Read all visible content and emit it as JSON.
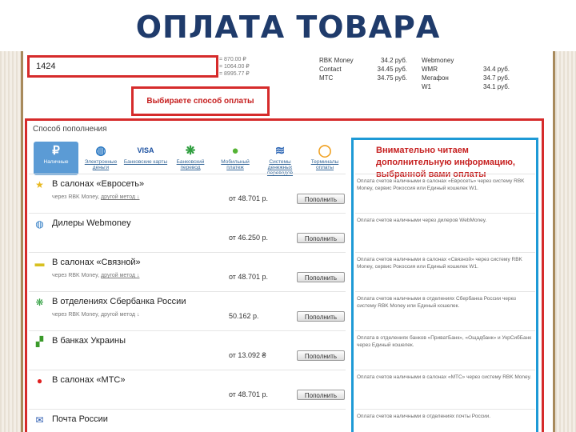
{
  "slide_title": "ОПЛАТА ТОВАРА",
  "top": {
    "account_value": "1424",
    "rates": [
      "= 870.00 ₽",
      "= 1064.00 ₽",
      "= 8995.77 ₽"
    ],
    "rate_table_left": [
      {
        "name": "RBK Money",
        "value": "34.2 руб."
      },
      {
        "name": "Contact",
        "value": "34.45 руб."
      },
      {
        "name": "МТС",
        "value": "34.75 руб."
      }
    ],
    "rate_table_right": [
      {
        "name": "Webmoney WMR",
        "value": "34.4 руб."
      },
      {
        "name": "Мегафон",
        "value": "34.7 руб."
      },
      {
        "name": "W1",
        "value": "34.1 руб."
      }
    ]
  },
  "annotation_choose": "Выбираете способ оплаты",
  "annotation_note": "Внимательно читаем дополнительную информацию, выбранной вами оплаты",
  "section_title": "Способ пополнения",
  "methods": [
    {
      "label": "Наличные",
      "icon": "ruble-icon",
      "glyph": "₽",
      "color": "#ffffff"
    },
    {
      "label": "Электронные деньги",
      "icon": "globe-icon",
      "glyph": "◍",
      "color": "#2a78c2"
    },
    {
      "label": "Банковские карты",
      "icon": "visa-icon",
      "glyph": "VISA",
      "color": "#1a4fa0"
    },
    {
      "label": "Банковский перевод",
      "icon": "sberbank-icon",
      "glyph": "❋",
      "color": "#2e9e3e"
    },
    {
      "label": "Мобильный платеж",
      "icon": "sms-icon",
      "glyph": "●",
      "color": "#55b334"
    },
    {
      "label": "Системы денежных переводов",
      "icon": "transfer-icon",
      "glyph": "≋",
      "color": "#3169b6"
    },
    {
      "label": "Терминалы оплаты",
      "icon": "terminal-icon",
      "glyph": "◯",
      "color": "#f0a020"
    }
  ],
  "rows": [
    {
      "title": "В салонах «Евросеть»",
      "sub": "через RBK Money, ",
      "sub_link": "другой метод ↓",
      "amount": "от 48.701 р.",
      "button": "Пополнить",
      "icon": "euroset-icon",
      "glyph": "★",
      "color": "#e8b820",
      "desc": "Оплата счетов наличными в салонах «Евросеть» через систему RBK Money, сервис Рокоссия или Единый кошелек W1."
    },
    {
      "title": "Дилеры Webmoney",
      "sub": "",
      "sub_link": "",
      "amount": "от 46.250 р.",
      "button": "Пополнить",
      "icon": "webmoney-icon",
      "glyph": "◍",
      "color": "#2a78c2",
      "desc": "Оплата счетов наличными через дилеров WebMoney."
    },
    {
      "title": "В салонах «Связной»",
      "sub": "через RBK Money, ",
      "sub_link": "другой метод ↓",
      "amount": "от 48.701 р.",
      "button": "Пополнить",
      "icon": "svyaznoy-icon",
      "glyph": "▬",
      "color": "#d8c020",
      "desc": "Оплата счетов наличными в салонах «Связной» через систему RBK Money, сервис Рокоссия или Единый кошелек W1."
    },
    {
      "title": "В отделениях Сбербанка России",
      "sub": "через RBK Money, другой метод ↓",
      "sub_link": "",
      "amount": "50.162 р.",
      "button": "Пополнить",
      "icon": "sberbank-row-icon",
      "glyph": "❋",
      "color": "#2e9e3e",
      "desc": "Оплата счетов наличными в отделениях Сбербанка России через систему RBK Money или Единый кошелек."
    },
    {
      "title": "В банках Украины",
      "sub": "",
      "sub_link": "",
      "amount": "от 13.092 ₴",
      "button": "Пополнить",
      "icon": "privatbank-icon",
      "glyph": "▞",
      "color": "#3a9a2a",
      "desc": "Оплата в отделениях банков «ПриватБанк», «Ощадбанк» и УкрСибБанк через Единый кошелек."
    },
    {
      "title": "В салонах «МТС»",
      "sub": "",
      "sub_link": "",
      "amount": "от 48.701 р.",
      "button": "Пополнить",
      "icon": "mts-icon",
      "glyph": "●",
      "color": "#e02020",
      "desc": "Оплата счетов наличными в салонах «МТС» через систему RBK Money."
    },
    {
      "title": "Почта России",
      "sub": "",
      "sub_link": "",
      "amount": "",
      "button": "",
      "icon": "post-icon",
      "glyph": "✉",
      "color": "#2a5ab0",
      "desc": "Оплата счетов наличными в отделениях почты России."
    }
  ]
}
